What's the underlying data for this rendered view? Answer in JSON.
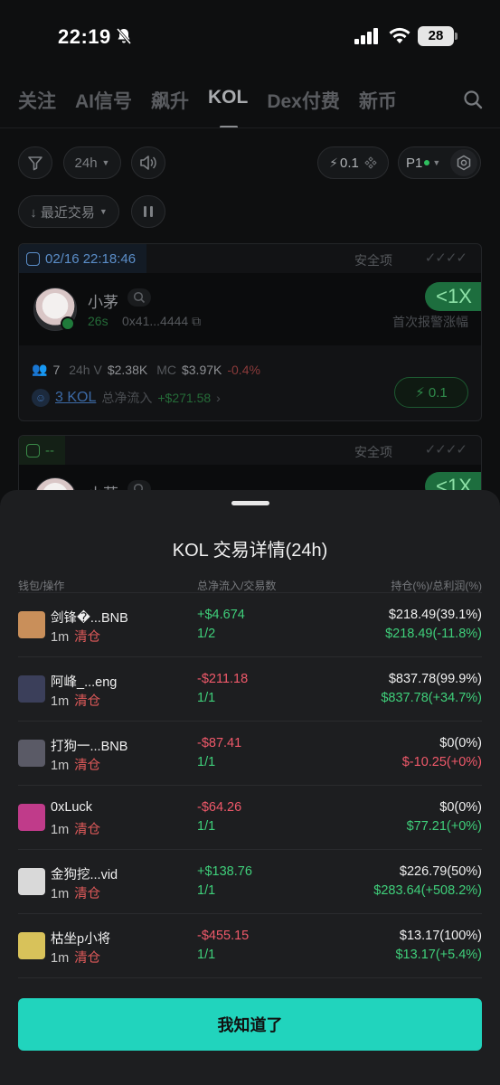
{
  "status": {
    "time": "22:19",
    "battery": "28"
  },
  "nav": {
    "tabs": [
      "关注",
      "AI信号",
      "飙升",
      "KOL",
      "Dex付费",
      "新币"
    ],
    "active_index": 3
  },
  "filters": {
    "time_range": "24h",
    "lightning_value": "0.1",
    "profile": "P1",
    "sort": "↓ 最近交易"
  },
  "cards": [
    {
      "timestamp": "02/16 22:18:46",
      "safety_label": "安全项",
      "name": "小茅",
      "age": "26s",
      "address": "0x41...4444",
      "tag": "<1X",
      "tag_sub": "首次报警涨幅",
      "holders": "7",
      "volume_label": "24h V",
      "volume": "$2.38K",
      "mc_label": "MC",
      "mc": "$3.97K",
      "change": "-0.4%",
      "kol_count": "3 KOL",
      "net_inflow_label": "总净流入",
      "net_inflow": "+$271.58",
      "buy_amount": "0.1"
    },
    {
      "timestamp": "--",
      "safety_label": "安全项",
      "name": "小茅",
      "tag": "<1X"
    }
  ],
  "sheet": {
    "title": "KOL 交易详情(24h)",
    "columns": [
      "钱包/操作",
      "总净流入/交易数",
      "持仓(%)/总利润(%)"
    ],
    "rows": [
      {
        "name": "剑锋�...BNB",
        "time": "1m",
        "action": "清仓",
        "flow": "+$4.674",
        "flow_sign": "pos",
        "txns": "1/2",
        "holding": "$218.49(39.1%)",
        "pnl": "$218.49(-11.8%)",
        "pnl_sign": "pos",
        "avatar_color": "#c98f5a"
      },
      {
        "name": "阿峰_...eng",
        "time": "1m",
        "action": "清仓",
        "flow": "-$211.18",
        "flow_sign": "neg",
        "txns": "1/1",
        "holding": "$837.78(99.9%)",
        "pnl": "$837.78(+34.7%)",
        "pnl_sign": "pos",
        "avatar_color": "#3b3f5a"
      },
      {
        "name": "打狗一...BNB",
        "time": "1m",
        "action": "清仓",
        "flow": "-$87.41",
        "flow_sign": "neg",
        "txns": "1/1",
        "holding": "$0(0%)",
        "pnl": "$-10.25(+0%)",
        "pnl_sign": "neg",
        "avatar_color": "#5a5a66"
      },
      {
        "name": "0xLuck",
        "time": "1m",
        "action": "清仓",
        "flow": "-$64.26",
        "flow_sign": "neg",
        "txns": "1/1",
        "holding": "$0(0%)",
        "pnl": "$77.21(+0%)",
        "pnl_sign": "pos",
        "avatar_color": "#c03b8a"
      },
      {
        "name": "金狗挖...vid",
        "time": "1m",
        "action": "清仓",
        "flow": "+$138.76",
        "flow_sign": "pos",
        "txns": "1/1",
        "holding": "$226.79(50%)",
        "pnl": "$283.64(+508.2%)",
        "pnl_sign": "pos",
        "avatar_color": "#d9d9d9"
      },
      {
        "name": "枯坐p小将",
        "time": "1m",
        "action": "清仓",
        "flow": "-$455.15",
        "flow_sign": "neg",
        "txns": "1/1",
        "holding": "$13.17(100%)",
        "pnl": "$13.17(+5.4%)",
        "pnl_sign": "pos",
        "avatar_color": "#d8c25a"
      }
    ],
    "confirm_label": "我知道了"
  }
}
